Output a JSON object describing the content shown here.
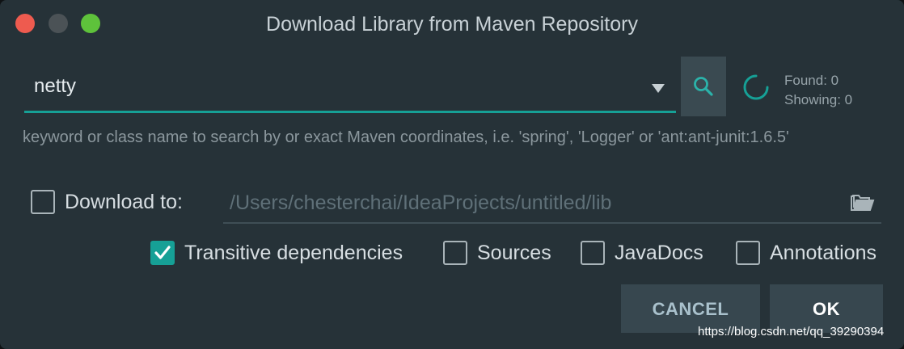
{
  "window": {
    "title": "Download Library from Maven Repository"
  },
  "search": {
    "query": "netty",
    "hint": "keyword or class name to search by or exact Maven coordinates, i.e. 'spring', 'Logger' or 'ant:ant-junit:1.6.5'"
  },
  "results": {
    "found": "Found: 0",
    "showing": "Showing: 0"
  },
  "download_to": {
    "label": "Download to:",
    "checked": false,
    "path": "/Users/chesterchai/IdeaProjects/untitled/lib"
  },
  "options": [
    {
      "label": "Transitive dependencies",
      "checked": true
    },
    {
      "label": "Sources",
      "checked": false
    },
    {
      "label": "JavaDocs",
      "checked": false
    },
    {
      "label": "Annotations",
      "checked": false
    }
  ],
  "buttons": {
    "cancel": "CANCEL",
    "ok": "OK"
  },
  "watermark": "https://blog.csdn.net/qq_39290394",
  "colors": {
    "background": "#263238",
    "accent": "#16a096",
    "button": "#37474f"
  },
  "icons": [
    "search-icon",
    "spinner-icon",
    "folder-open-icon",
    "dropdown-arrow-icon",
    "checkmark-icon"
  ]
}
